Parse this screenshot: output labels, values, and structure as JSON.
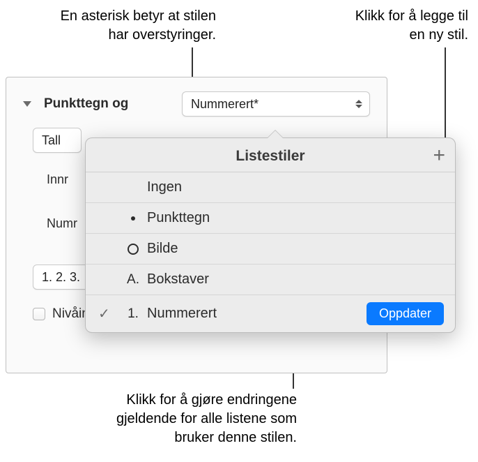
{
  "callouts": {
    "asterisk": "En asterisk betyr at stilen\nhar overstyringer.",
    "add": "Klikk for å legge til\nen ny stil.",
    "update": "Klikk for å gjøre endringene\ngjeldende for alle listene som\nbruker denne stilen."
  },
  "section": {
    "title": "Punkttegn og",
    "selected_style": "Nummerert*",
    "number_format_label": "Tall",
    "indent_label": "Innr",
    "number_label": "Numr",
    "sequence_label": "1. 2. 3.",
    "tiered_label": "Nivåinndelt nummerering"
  },
  "popover": {
    "title": "Listestiler",
    "add_icon": "+",
    "update_label": "Oppdater",
    "items": [
      {
        "label": "Ingen",
        "marker": "none"
      },
      {
        "label": "Punkttegn",
        "marker": "bullet"
      },
      {
        "label": "Bilde",
        "marker": "circle"
      },
      {
        "label": "Bokstaver",
        "marker": "A."
      },
      {
        "label": "Nummerert",
        "marker": "1.",
        "selected": true
      }
    ]
  }
}
